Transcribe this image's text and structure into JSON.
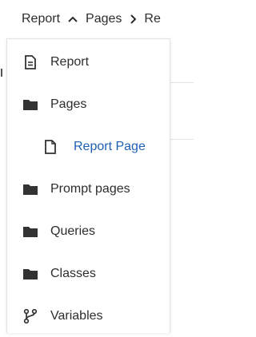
{
  "breadcrumb": {
    "items": [
      {
        "label": "Report"
      },
      {
        "label": "Pages"
      },
      {
        "label": "Re"
      }
    ],
    "separators": [
      "chevron-up-icon",
      "chevron-right-icon"
    ]
  },
  "menu": {
    "items": [
      {
        "label": "Report",
        "icon": "report-document-icon"
      },
      {
        "label": "Pages",
        "icon": "folder-icon"
      },
      {
        "label": "Report Page",
        "icon": "page-icon",
        "selected": true
      },
      {
        "label": "Prompt pages",
        "icon": "folder-icon"
      },
      {
        "label": "Queries",
        "icon": "folder-icon"
      },
      {
        "label": "Classes",
        "icon": "folder-icon"
      },
      {
        "label": "Variables",
        "icon": "variables-branch-icon"
      }
    ]
  },
  "colors": {
    "text": "#2d2d2d",
    "selected": "#1f5fb3",
    "icon": "#333333"
  }
}
